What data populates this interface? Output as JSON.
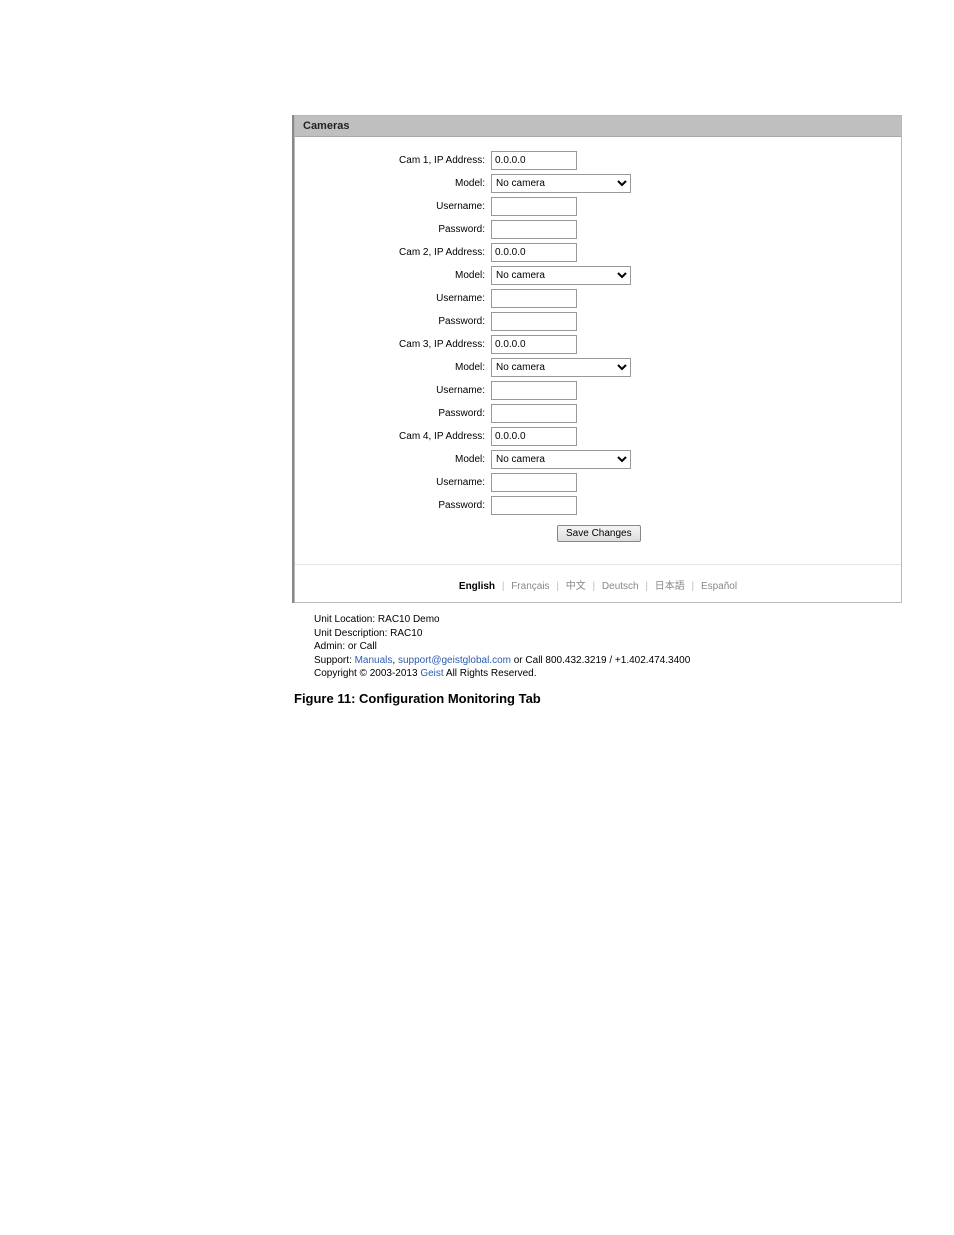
{
  "panel": {
    "title": "Cameras"
  },
  "cameras": [
    {
      "ip_label": "Cam 1, IP Address:",
      "ip_value": "0.0.0.0",
      "model_label": "Model:",
      "model_value": "No camera",
      "user_label": "Username:",
      "user_value": "",
      "pass_label": "Password:",
      "pass_value": ""
    },
    {
      "ip_label": "Cam 2, IP Address:",
      "ip_value": "0.0.0.0",
      "model_label": "Model:",
      "model_value": "No camera",
      "user_label": "Username:",
      "user_value": "",
      "pass_label": "Password:",
      "pass_value": ""
    },
    {
      "ip_label": "Cam 3, IP Address:",
      "ip_value": "0.0.0.0",
      "model_label": "Model:",
      "model_value": "No camera",
      "user_label": "Username:",
      "user_value": "",
      "pass_label": "Password:",
      "pass_value": ""
    },
    {
      "ip_label": "Cam 4, IP Address:",
      "ip_value": "0.0.0.0",
      "model_label": "Model:",
      "model_value": "No camera",
      "user_label": "Username:",
      "user_value": "",
      "pass_label": "Password:",
      "pass_value": ""
    }
  ],
  "save_button": "Save Changes",
  "languages": {
    "current": "English",
    "others": [
      "Français",
      "中文",
      "Deutsch",
      "日本語",
      "Español"
    ]
  },
  "footer": {
    "location": "Unit Location: RAC10 Demo",
    "description": "Unit Description: RAC10",
    "admin": "Admin: or Call",
    "support_prefix": "Support: ",
    "manuals_link": "Manuals",
    "sep1": ", ",
    "email_link": "support@geistglobal.com",
    "support_suffix": " or Call 800.432.3219 / +1.402.474.3400",
    "copyright_prefix": "Copyright © 2003-2013 ",
    "geist_link": "Geist",
    "copyright_suffix": " All Rights Reserved."
  },
  "caption": "Figure 11: Configuration Monitoring Tab"
}
